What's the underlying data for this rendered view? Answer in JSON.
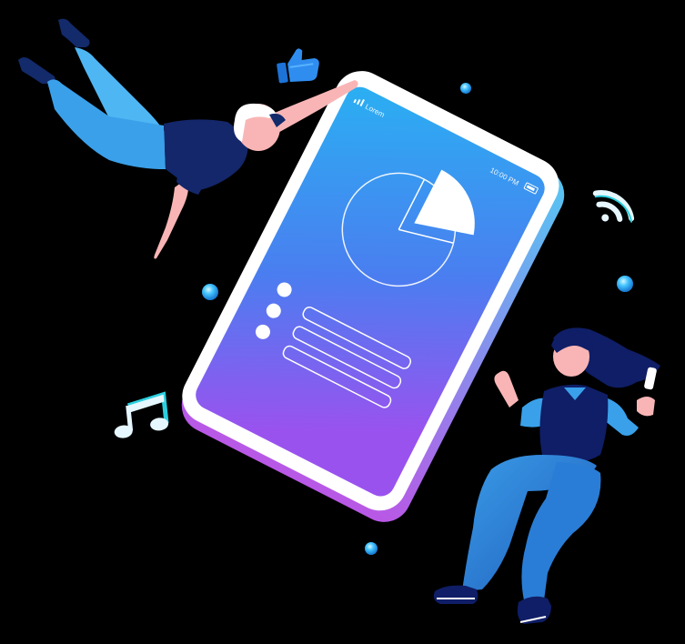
{
  "phone": {
    "carrier_label": "Lorem",
    "clock_label": "10:00 PM"
  },
  "icons": [
    "thumbs-up-icon",
    "wifi-icon",
    "music-note-icon",
    "pie-chart-icon",
    "signal-bars-icon",
    "battery-icon"
  ],
  "colors": {
    "background": "#000000",
    "screen_top": "#2aa7ee",
    "screen_bottom": "#8a5cf0",
    "phone_body": "#ffffff",
    "phone_glow": "#b06cf2",
    "bubble": "#35b8f5",
    "navy": "#0d1a5c",
    "denim": "#2a7dd6"
  }
}
